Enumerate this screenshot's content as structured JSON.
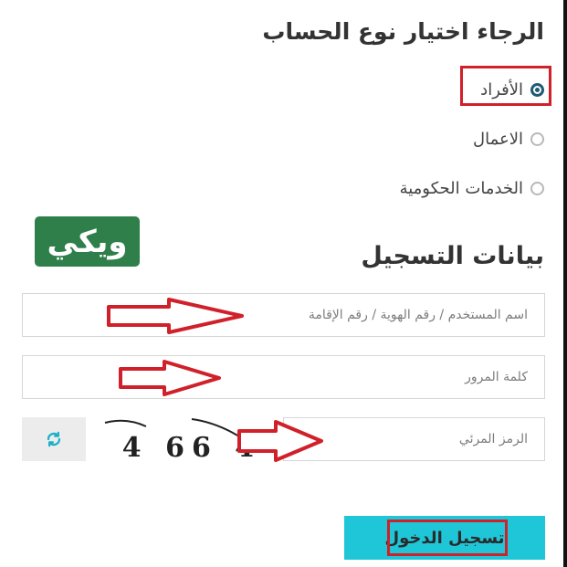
{
  "account_type": {
    "title": "الرجاء اختيار نوع الحساب",
    "options": [
      {
        "label": "الأفراد",
        "selected": true
      },
      {
        "label": "الاعمال",
        "selected": false
      },
      {
        "label": "الخدمات الحكومية",
        "selected": false
      }
    ]
  },
  "logo": {
    "text": "ويكي"
  },
  "registration": {
    "title": "بيانات التسجيل",
    "username_placeholder": "اسم المستخدم / رقم الهوية / رقم الإقامة",
    "password_placeholder": "كلمة المرور",
    "captcha_placeholder": "الرمز المرئي",
    "captcha_text": "4 66 4",
    "refresh_icon": "refresh-icon",
    "login_label": "تسجيل الدخول"
  },
  "colors": {
    "accent": "#1fc6d8",
    "highlight": "#d0202a",
    "radio_selected": "#1f5b73",
    "logo_bg": "#2f7f4a"
  }
}
